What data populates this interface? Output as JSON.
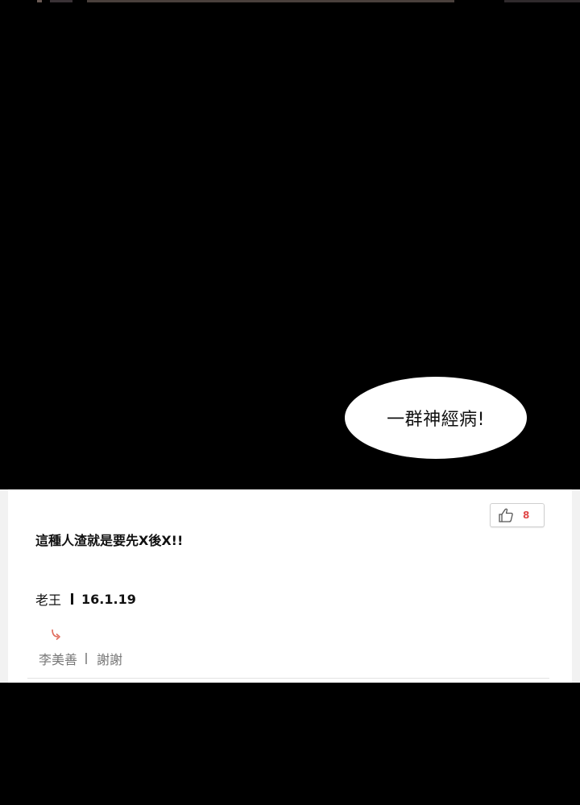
{
  "panel": {
    "speech_bubble_text": "一群神經病!"
  },
  "comment": {
    "like_count": "8",
    "text": "這種人渣就是要先X後X!!",
    "author": "老王",
    "date": "16.1.19",
    "reply": {
      "author": "李美善",
      "text": "謝謝"
    }
  },
  "icons": {
    "like": "thumbs-up-icon",
    "reply": "reply-arrow-icon"
  },
  "colors": {
    "like_count": "#e04848",
    "reply_arrow": "#e06a5a",
    "reply_text": "#777777"
  }
}
